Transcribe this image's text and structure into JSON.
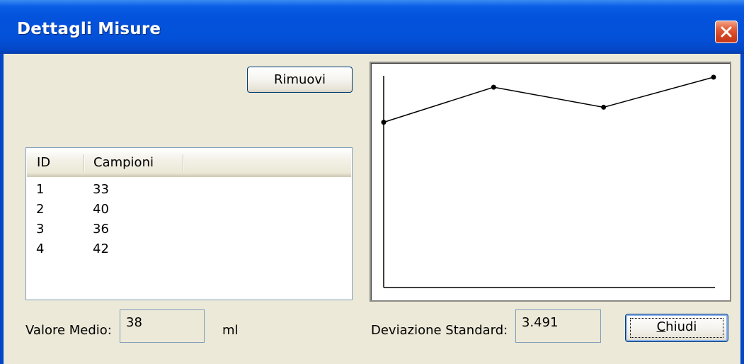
{
  "window": {
    "title": "Dettagli Misure"
  },
  "buttons": {
    "remove_label": "Rimuovi",
    "close_label_mnemonic": "C",
    "close_label_rest": "hiudi"
  },
  "list": {
    "columns": [
      "ID",
      "Campioni"
    ],
    "rows": [
      {
        "id": "1",
        "value": "33"
      },
      {
        "id": "2",
        "value": "40"
      },
      {
        "id": "3",
        "value": "36"
      },
      {
        "id": "4",
        "value": "42"
      }
    ]
  },
  "stats": {
    "mean_label": "Valore Medio:",
    "mean_value": "38",
    "mean_unit": "ml",
    "std_label": "Deviazione Standard:",
    "std_value": "3.491"
  },
  "chart_data": {
    "type": "line",
    "x": [
      1,
      2,
      3,
      4
    ],
    "values": [
      33,
      40,
      36,
      42
    ],
    "ylim": [
      0,
      42
    ],
    "grid": false,
    "color": "#000000"
  },
  "colors": {
    "titlebar": "#0453dc",
    "close": "#d2421f",
    "face": "#ece9d8"
  }
}
